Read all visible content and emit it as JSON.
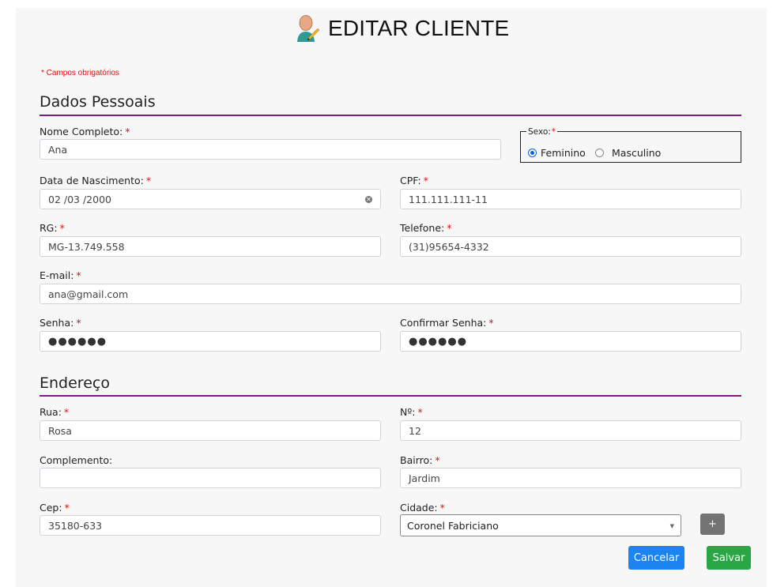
{
  "page": {
    "title": "EDITAR CLIENTE",
    "required_note": "* Campos obrigatórios"
  },
  "sections": {
    "personal": "Dados Pessoais",
    "address": "Endereço"
  },
  "fields": {
    "nome": {
      "label": "Nome Completo:",
      "value": "Ana"
    },
    "sexo": {
      "legend": "Sexo:",
      "options": [
        "Feminino",
        "Masculino"
      ],
      "selected": "Feminino"
    },
    "nascimento": {
      "label": "Data de Nascimento:",
      "value": "02 /03 /2000"
    },
    "cpf": {
      "label": "CPF:",
      "value": "111.111.111-11"
    },
    "rg": {
      "label": "RG:",
      "value": "MG-13.749.558"
    },
    "telefone": {
      "label": "Telefone:",
      "value": "(31)95654-4332"
    },
    "email": {
      "label": "E-mail:",
      "value": "ana@gmail.com"
    },
    "senha": {
      "label": "Senha:",
      "value": "●●●●●●"
    },
    "confirmar": {
      "label": "Confirmar Senha:",
      "value": "●●●●●●"
    },
    "rua": {
      "label": "Rua:",
      "value": "Rosa"
    },
    "numero": {
      "label": "Nº:",
      "value": "12"
    },
    "complemento": {
      "label": "Complemento:",
      "value": ""
    },
    "bairro": {
      "label": "Bairro:",
      "value": "Jardim"
    },
    "cep": {
      "label": "Cep:",
      "value": "35180-633"
    },
    "cidade": {
      "label": "Cidade:",
      "value": "Coronel Fabriciano"
    }
  },
  "required_mark": "*",
  "buttons": {
    "add": "+",
    "cancel": "Cancelar",
    "save": "Salvar"
  },
  "icons": {
    "title": "user-edit-icon",
    "date_clear": "clear-icon",
    "select": "caret-down-icon"
  },
  "colors": {
    "accent_rule": "#7b1e7f",
    "required": "#e01010",
    "cancel": "#1a84f0",
    "save": "#29a744",
    "add": "#737373"
  }
}
